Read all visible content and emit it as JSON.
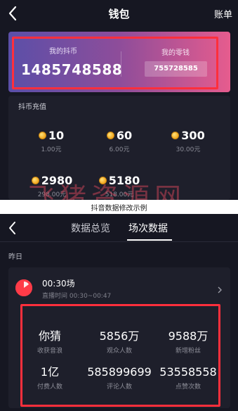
{
  "wallet": {
    "title": "钱包",
    "right_link": "账单",
    "coin_label": "我的抖币",
    "coin_amount": "1485748588",
    "change_label": "我的零钱",
    "change_amount": "755728585",
    "recharge_title": "抖币充值",
    "options": [
      {
        "coins": "10",
        "price": "1.00元"
      },
      {
        "coins": "60",
        "price": "6.00元"
      },
      {
        "coins": "300",
        "price": "30.00元"
      },
      {
        "coins": "2980",
        "price": "298.00元"
      },
      {
        "coins": "5180",
        "price": "518.00元"
      }
    ],
    "watermark": "飞猪资源网"
  },
  "caption": "抖音数据修改示例",
  "data_screen": {
    "tabs": [
      {
        "label": "数据总览",
        "active": false
      },
      {
        "label": "场次数据",
        "active": true
      }
    ],
    "section_label": "昨日",
    "session": {
      "title": "00:30场",
      "time": "直播时间 00:30~00:47"
    },
    "stats": [
      {
        "value": "你猜",
        "label": "收获音浪"
      },
      {
        "value": "5856万",
        "label": "观众人数"
      },
      {
        "value": "9588万",
        "label": "新增粉丝"
      },
      {
        "value": "1亿",
        "label": "付费人数"
      },
      {
        "value": "585899699",
        "label": "评论人数"
      },
      {
        "value": "53558558",
        "label": "点赞次数"
      }
    ]
  },
  "colors": {
    "background": "#161722",
    "panel": "#1e1f2b",
    "highlight": "#ff2f3c",
    "coin": "#f2a81f",
    "session_icon": "#ff3b48"
  }
}
